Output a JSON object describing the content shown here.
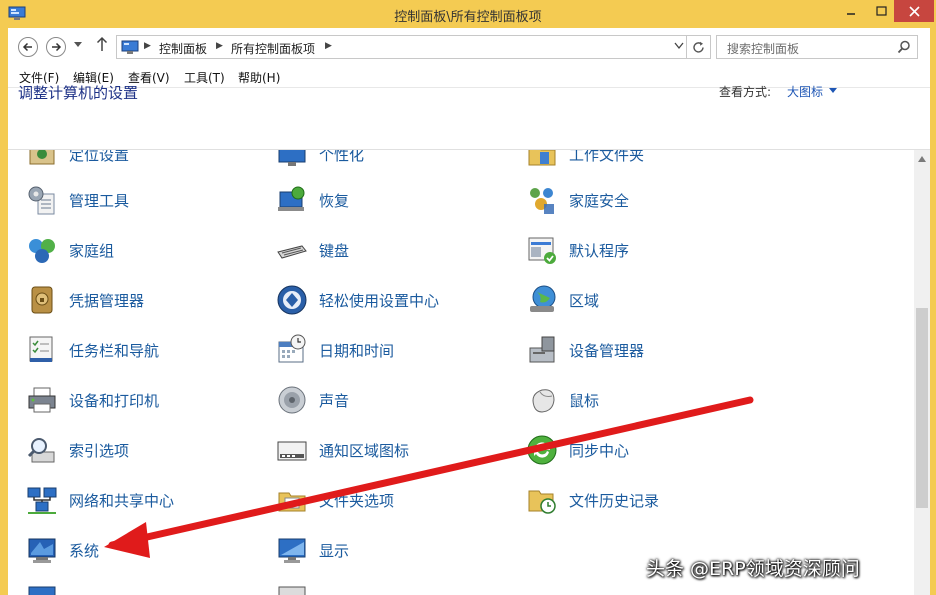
{
  "window": {
    "title": "控制面板\\所有控制面板项",
    "colors": {
      "frame": "#f4cb52",
      "close": "#c7463f",
      "link": "#1a5a9e",
      "title": "#1e3287"
    }
  },
  "address": {
    "crumbs": [
      "控制面板",
      "所有控制面板项"
    ],
    "search_placeholder": "搜索控制面板"
  },
  "menu": [
    "文件(F)",
    "编辑(E)",
    "查看(V)",
    "工具(T)",
    "帮助(H)"
  ],
  "header": {
    "title": "调整计算机的设置",
    "view_label": "查看方式:",
    "view_value": "大图标"
  },
  "items": [
    {
      "label": "定位设置",
      "icon": "location-settings-icon"
    },
    {
      "label": "个性化",
      "icon": "personalization-icon"
    },
    {
      "label": "工作文件夹",
      "icon": "work-folders-icon"
    },
    {
      "label": "管理工具",
      "icon": "admin-tools-icon"
    },
    {
      "label": "恢复",
      "icon": "recovery-icon"
    },
    {
      "label": "家庭安全",
      "icon": "family-safety-icon"
    },
    {
      "label": "家庭组",
      "icon": "homegroup-icon"
    },
    {
      "label": "键盘",
      "icon": "keyboard-icon"
    },
    {
      "label": "默认程序",
      "icon": "default-programs-icon"
    },
    {
      "label": "凭据管理器",
      "icon": "credential-manager-icon"
    },
    {
      "label": "轻松使用设置中心",
      "icon": "ease-of-access-icon"
    },
    {
      "label": "区域",
      "icon": "region-icon"
    },
    {
      "label": "任务栏和导航",
      "icon": "taskbar-icon"
    },
    {
      "label": "日期和时间",
      "icon": "calendar-clock-icon"
    },
    {
      "label": "设备管理器",
      "icon": "device-manager-icon"
    },
    {
      "label": "设备和打印机",
      "icon": "printer-icon"
    },
    {
      "label": "声音",
      "icon": "speaker-icon"
    },
    {
      "label": "鼠标",
      "icon": "mouse-icon"
    },
    {
      "label": "索引选项",
      "icon": "indexing-icon"
    },
    {
      "label": "通知区域图标",
      "icon": "notification-icon"
    },
    {
      "label": "同步中心",
      "icon": "sync-center-icon"
    },
    {
      "label": "网络和共享中心",
      "icon": "network-icon"
    },
    {
      "label": "文件夹选项",
      "icon": "folder-options-icon"
    },
    {
      "label": "文件历史记录",
      "icon": "file-history-icon"
    },
    {
      "label": "系统",
      "icon": "system-icon"
    },
    {
      "label": "显示",
      "icon": "display-icon"
    }
  ],
  "watermark": "头条 @ERP领域资深顾问"
}
